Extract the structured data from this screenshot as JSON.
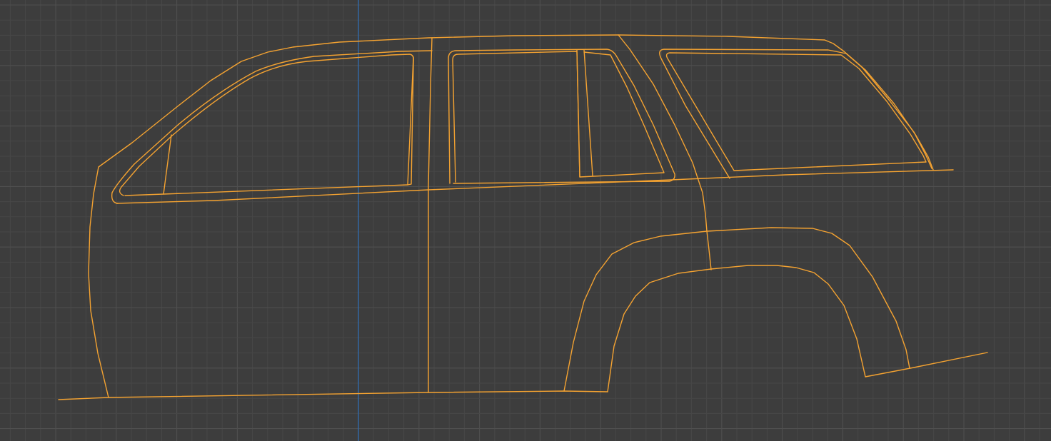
{
  "viewport": {
    "background_color": "#3d3d3d",
    "grid_minor_color": "#474747",
    "grid_major_color": "#4f4f4f",
    "y_axis_color": "#2f6fb8",
    "wire_color": "#f5a331"
  }
}
